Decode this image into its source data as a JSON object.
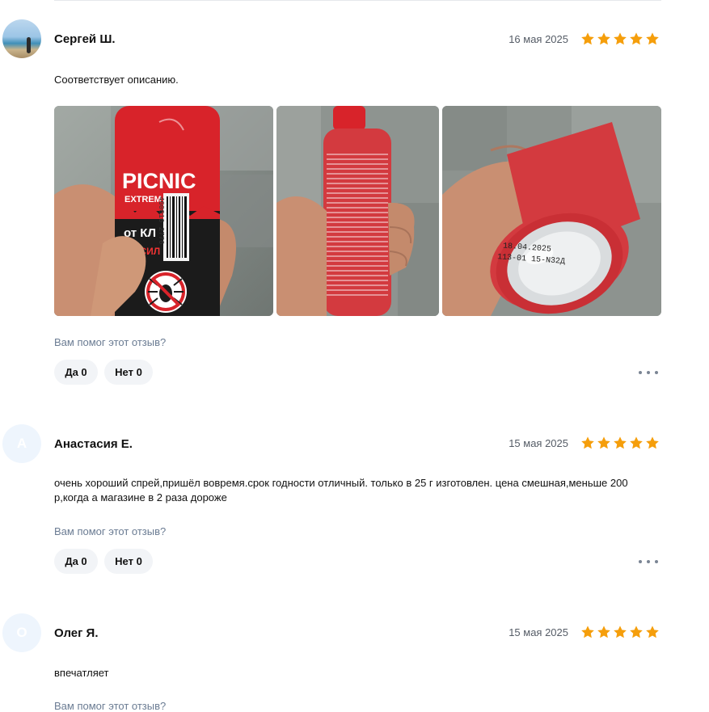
{
  "reviews": [
    {
      "author": "Сергей Ш.",
      "date": "16 мая 2025",
      "rating": 5,
      "text": "Соответствует описанию.",
      "photos": [
        {
          "label_brand": "PICNIC",
          "label_line": "EXTREM",
          "label_from": "от КЛ",
          "label_strong": "УСИЛ",
          "barcode_digits": "460016 2776"
        },
        {},
        {
          "print_line1": "18.04.2025",
          "print_line2": "113-01 15-N32Д"
        }
      ],
      "helpful_question": "Вам помог этот отзыв?",
      "yes_label": "Да 0",
      "no_label": "Нет 0"
    },
    {
      "author": "Анастасия Е.",
      "avatar_letter": "А",
      "date": "15 мая 2025",
      "rating": 5,
      "text": "очень хороший спрей,пришёл вовремя.срок годности отличный. только в 25 г изготовлен. цена смешная,меньше 200 р,когда а магазине в 2 раза дороже",
      "helpful_question": "Вам помог этот отзыв?",
      "yes_label": "Да 0",
      "no_label": "Нет 0"
    },
    {
      "author": "Олег Я.",
      "avatar_letter": "О",
      "date": "15 мая 2025",
      "rating": 5,
      "text": "впечатляет",
      "helpful_question": "Вам помог этот отзыв?"
    }
  ],
  "colors": {
    "star": "#f59e0b",
    "helpful_link": "#6b7c93",
    "button_bg": "#f2f4f7"
  }
}
